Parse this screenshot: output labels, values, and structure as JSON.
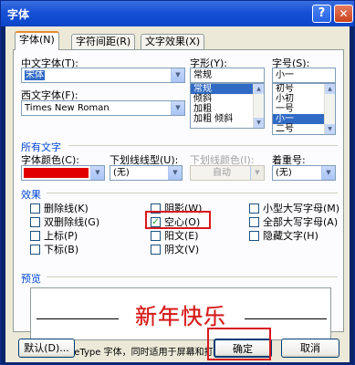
{
  "window": {
    "title": "字体",
    "help_label": "?",
    "close_label": "✕"
  },
  "tabs": [
    {
      "label": "字体(N)",
      "active": true
    },
    {
      "label": "字符间距(R)",
      "active": false
    },
    {
      "label": "文字效果(X)",
      "active": false
    }
  ],
  "font": {
    "cn_label": "中文字体(T):",
    "cn_value": "宋体",
    "west_label": "西文字体(F):",
    "west_value": "Times New Roman"
  },
  "style": {
    "label": "字形(Y):",
    "value": "常规",
    "options": [
      "常规",
      "倾斜",
      "加粗",
      "加粗 倾斜"
    ],
    "selected_index": 0
  },
  "size": {
    "label": "字号(S):",
    "value": "小一",
    "options": [
      "初号",
      "小初",
      "一号",
      "小一",
      "二号"
    ],
    "selected_index": 3
  },
  "all_text": {
    "group_label": "所有文字",
    "color_label": "字体颜色(C):",
    "color_value": "#e00000",
    "underline_label": "下划线线型(U):",
    "underline_value": "(无)",
    "underline_color_label": "下划线颜色(I):",
    "underline_color_value": "自动",
    "emphasis_label": "着重号:",
    "emphasis_value": "(无)"
  },
  "effects": {
    "group_label": "效果",
    "items": [
      {
        "label": "删除线(K)",
        "checked": false
      },
      {
        "label": "双删除线(G)",
        "checked": false
      },
      {
        "label": "上标(P)",
        "checked": false
      },
      {
        "label": "下标(B)",
        "checked": false
      },
      {
        "label": "阴影(W)",
        "checked": false
      },
      {
        "label": "空心(O)",
        "checked": true
      },
      {
        "label": "阳文(E)",
        "checked": false
      },
      {
        "label": "阴文(V)",
        "checked": false
      },
      {
        "label": "小型大写字母(M)",
        "checked": false
      },
      {
        "label": "全部大写字母(A)",
        "checked": false
      },
      {
        "label": "隐藏文字(H)",
        "checked": false
      }
    ]
  },
  "preview": {
    "group_label": "预览",
    "sample_text": "新年快乐",
    "note": "这是一种 TrueType 字体，同时适用于屏幕和打印机。"
  },
  "buttons": {
    "default": "默认(D)...",
    "ok": "确定",
    "cancel": "取消"
  },
  "colors": {
    "accent": "#316ac5",
    "highlight_box": "#d8181e",
    "preview_text": "#d81c1c"
  }
}
